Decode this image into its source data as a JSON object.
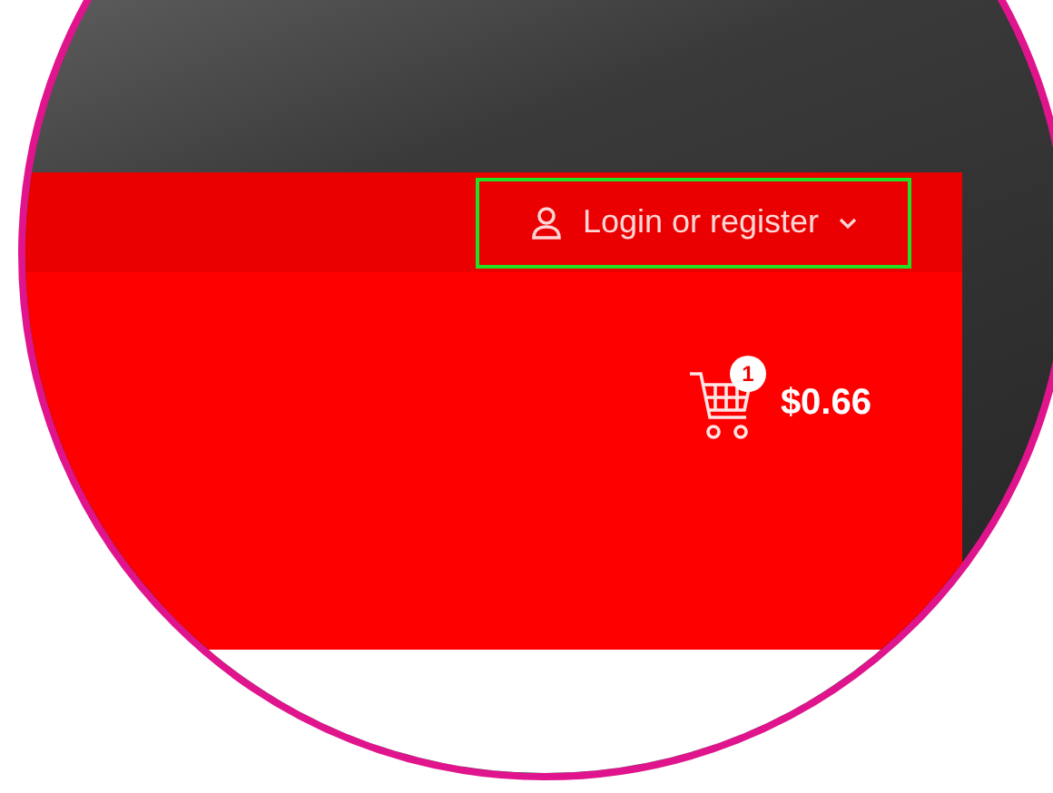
{
  "top_bar": {
    "account_link": {
      "label": "Login or register",
      "highlighted": true
    }
  },
  "header": {
    "cart": {
      "count": "1",
      "total": "$0.66"
    }
  }
}
